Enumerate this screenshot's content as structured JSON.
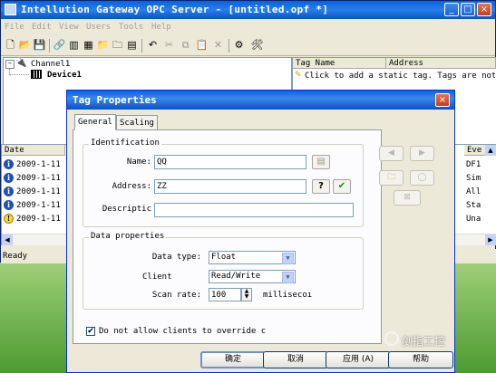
{
  "main_window": {
    "title": "Intellution Gateway OPC Server - [untitled.opf *]",
    "title_buttons": [
      "_",
      "□",
      "×"
    ],
    "menu": [
      "File",
      "Edit",
      "View",
      "Users",
      "Tools",
      "Help"
    ],
    "tree": {
      "channel": "Channel1",
      "device": "Device1"
    },
    "tag_columns": [
      "Tag Name",
      "Address"
    ],
    "tag_hint": "Click to add a static tag.  Tags are not",
    "log_columns": [
      "Date",
      "Eve"
    ],
    "log_rows": [
      {
        "icon": "info-icon",
        "date": "2009-1-11",
        "event": "DF1"
      },
      {
        "icon": "info-icon",
        "date": "2009-1-11",
        "event": "Sim"
      },
      {
        "icon": "info-icon",
        "date": "2009-1-11",
        "event": "All"
      },
      {
        "icon": "info-icon",
        "date": "2009-1-11",
        "event": "Sta"
      },
      {
        "icon": "warning-icon",
        "date": "2009-1-11",
        "event": "Una"
      }
    ],
    "status": "Ready"
  },
  "dialog": {
    "title": "Tag Properties",
    "tabs": [
      "General",
      "Scaling"
    ],
    "identification": {
      "label": "Identification",
      "name_label": "Name:",
      "name_value": "QQ",
      "address_label": "Address:",
      "address_value": "ZZ",
      "description_label": "Descriptic",
      "description_value": ""
    },
    "data_properties": {
      "label": "Data properties",
      "data_type_label": "Data type:",
      "data_type_value": "Float",
      "client_label": "Client",
      "client_value": "Read/Write",
      "scan_rate_label": "Scan rate:",
      "scan_rate_value": "100",
      "scan_rate_unit": "millisecoı"
    },
    "override_checkbox": {
      "label": "Do not allow clients to override c",
      "checked": true
    },
    "buttons": {
      "ok": "确定",
      "cancel": "取消",
      "apply": "应用 (A)",
      "help": "帮助"
    }
  },
  "watermark": "剑指工控",
  "colors": {
    "titlebar": "#0a62e0",
    "ok_green": "#1a8a1a"
  }
}
